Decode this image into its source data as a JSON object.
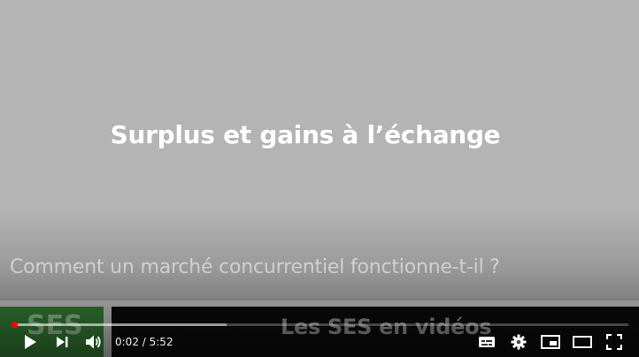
{
  "video": {
    "slide_title": "Surplus et gains à l’échange",
    "slide_subtitle": "Comment un marché concurrentiel fonctionne-t-il ?",
    "logo_text": "SES",
    "banner_text": "Les SES en vidéos"
  },
  "player": {
    "current_time": "0:02",
    "time_separator": " / ",
    "duration": "5:52",
    "progress_fraction": 0.006,
    "buffered_fraction": 0.35,
    "accent_color": "#ff0000",
    "icons": {
      "play": "play-icon",
      "next": "next-icon",
      "volume": "volume-icon",
      "subtitles": "subtitles-icon",
      "settings": "gear-icon",
      "miniplayer": "miniplayer-icon",
      "theater": "theater-icon",
      "fullscreen": "fullscreen-icon"
    }
  }
}
